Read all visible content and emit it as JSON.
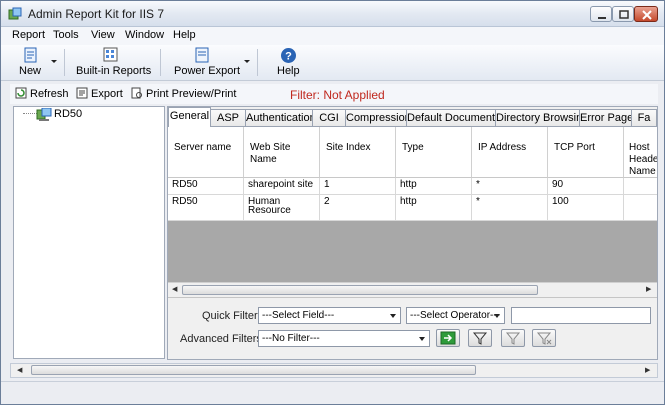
{
  "window": {
    "title": "Admin Report Kit for IIS 7"
  },
  "menu": [
    "Report",
    "Tools",
    "View",
    "Window",
    "Help"
  ],
  "toolbar": {
    "new_label": "New",
    "builtin_label": "Built-in Reports",
    "power_export_label": "Power Export",
    "help_label": "Help"
  },
  "actions": {
    "refresh": "Refresh",
    "export": "Export",
    "print": "Print Preview/Print",
    "filter_status": "Filter: Not Applied"
  },
  "tree": {
    "root": "RD50"
  },
  "tabs": [
    "General",
    "ASP",
    "Authentication",
    "CGI",
    "Compression",
    "Default Documents",
    "Directory Browsing",
    "Error Page",
    "Fa"
  ],
  "grid": {
    "columns": [
      "Server name",
      "Web Site Name",
      "Site Index",
      "Type",
      "IP Address",
      "TCP Port",
      "Host Header Name"
    ],
    "rows": [
      [
        "RD50",
        "sharepoint site",
        "1",
        "http",
        "*",
        "90",
        ""
      ],
      [
        "RD50",
        "Human Resource",
        "2",
        "http",
        "*",
        "100",
        ""
      ]
    ]
  },
  "filters": {
    "quick_label": "Quick Filter:",
    "field_value": "---Select Field---",
    "operator_value": "---Select Operator---",
    "advanced_label": "Advanced Filters:",
    "advanced_value": "---No Filter---"
  },
  "colors": {
    "filter_status": "#c0281e",
    "accent": "#2a64b5"
  }
}
